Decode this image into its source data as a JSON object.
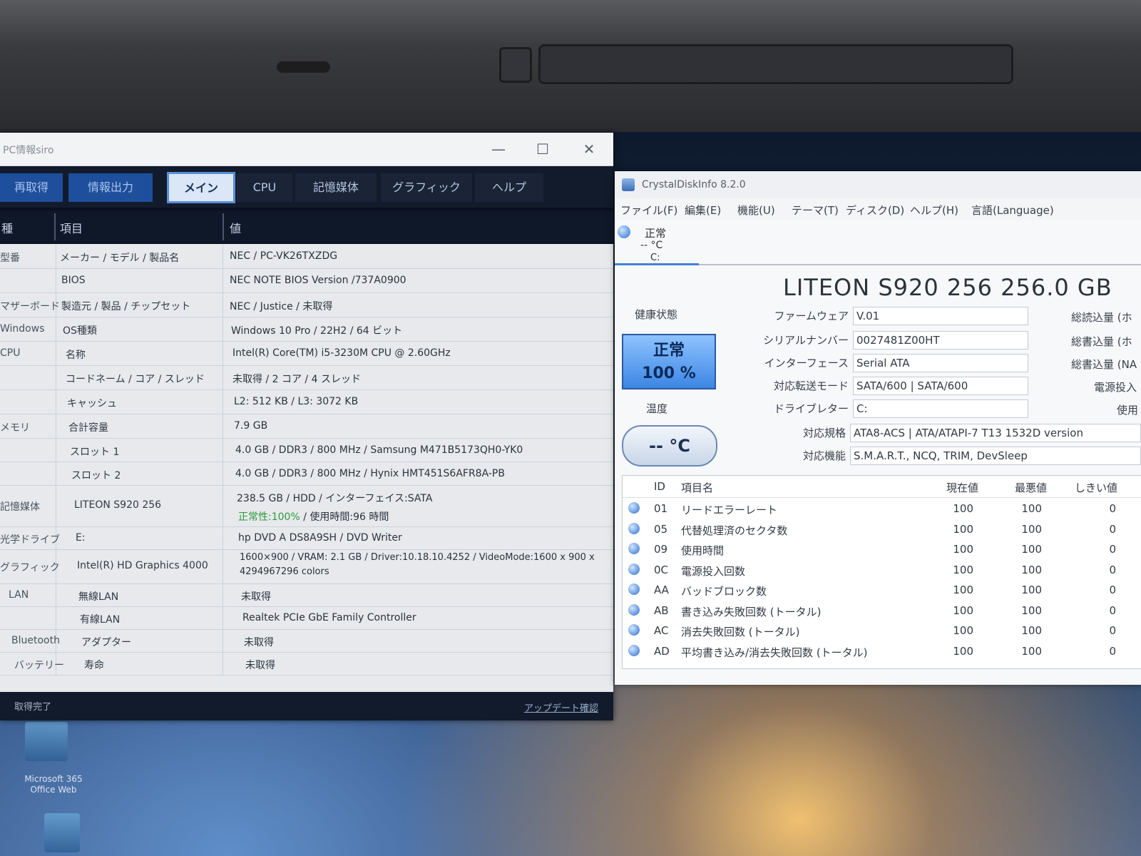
{
  "desktop": {
    "icon_label": "Microsoft 365 Office Web"
  },
  "pcinfo": {
    "title": "PC情報siro",
    "window_buttons": {
      "minimize": "—",
      "maximize": "☐",
      "close": "✕"
    },
    "toolbar": {
      "refresh": "再取得",
      "export": "情報出力",
      "tabs": [
        "メイン",
        "CPU",
        "記憶媒体",
        "グラフィック",
        "ヘルプ"
      ]
    },
    "columns": {
      "category": "種",
      "item": "項目",
      "value": "値"
    },
    "rows": [
      {
        "category": "型番",
        "item": "メーカー / モデル / 製品名",
        "value": "NEC / PC-VK26TXZDG"
      },
      {
        "category": "",
        "item": "BIOS",
        "value": "NEC NOTE BIOS Version /737A0900"
      },
      {
        "category": "マザーボード",
        "item": "製造元 / 製品 / チップセット",
        "value": "NEC / Justice / 未取得"
      },
      {
        "category": "Windows",
        "item": "OS種類",
        "value": "Windows 10 Pro / 22H2 / 64 ビット"
      },
      {
        "category": "CPU",
        "item": "名称",
        "value": "Intel(R) Core(TM) i5-3230M CPU @ 2.60GHz"
      },
      {
        "category": "",
        "item": "コードネーム / コア / スレッド",
        "value": "未取得 / 2 コア / 4 スレッド"
      },
      {
        "category": "",
        "item": "キャッシュ",
        "value": "L2: 512 KB / L3: 3072 KB"
      },
      {
        "category": "メモリ",
        "item": "合計容量",
        "value": "7.9 GB"
      },
      {
        "category": "",
        "item": "スロット 1",
        "value": "4.0 GB / DDR3 / 800 MHz / Samsung M471B5173QH0-YK0"
      },
      {
        "category": "",
        "item": "スロット 2",
        "value": "4.0 GB / DDR3 / 800 MHz / Hynix HMT451S6AFR8A-PB"
      },
      {
        "category": "記憶媒体",
        "item": "LITEON S920 256",
        "value": "238.5 GB / HDD / インターフェイス:SATA",
        "value_health": "正常性:100%",
        "value_hours": " / 使用時間:96 時間"
      },
      {
        "category": "光学ドライブ",
        "item": "E:",
        "value": "hp DVD A DS8A9SH / DVD Writer"
      },
      {
        "category": "グラフィック",
        "item": "Intel(R) HD Graphics 4000",
        "value": "1600×900 / VRAM: 2.1 GB / Driver:10.18.10.4252 / VideoMode:1600 x 900 x",
        "value2": "4294967296 colors"
      },
      {
        "category": "LAN",
        "item": "無線LAN",
        "value": "未取得"
      },
      {
        "category": "",
        "item": "有線LAN",
        "value": "Realtek PCIe GbE Family Controller"
      },
      {
        "category": "Bluetooth",
        "item": "アダプター",
        "value": "未取得"
      },
      {
        "category": "バッテリー",
        "item": "寿命",
        "value": "未取得"
      }
    ],
    "status": {
      "left": "取得完了",
      "update_link": "アップデート確認"
    }
  },
  "cdi": {
    "title": "CrystalDiskInfo 8.2.0",
    "menu": [
      "ファイル(F)",
      "編集(E)",
      "機能(U)",
      "テーマ(T)",
      "ディスク(D)",
      "ヘルプ(H)",
      "言語(Language)"
    ],
    "drive_tab": {
      "status": "正常",
      "temp": "-- °C",
      "letter": "C:"
    },
    "model": "LITEON S920 256 256.0 GB",
    "health_label": "健康状態",
    "health_status": "正常",
    "health_percent": "100 %",
    "temp_label": "温度",
    "temp_value": "-- °C",
    "fields": [
      {
        "label": "ファームウェア",
        "value": "V.01"
      },
      {
        "label": "シリアルナンバー",
        "value": "0027481Z00HT"
      },
      {
        "label": "インターフェース",
        "value": "Serial ATA"
      },
      {
        "label": "対応転送モード",
        "value": "SATA/600 | SATA/600"
      },
      {
        "label": "ドライブレター",
        "value": "C:"
      },
      {
        "label": "対応規格",
        "value": "ATA8-ACS | ATA/ATAPI-7 T13 1532D version"
      },
      {
        "label": "対応機能",
        "value": "S.M.A.R.T., NCQ, TRIM, DevSleep"
      }
    ],
    "right_labels": [
      "総読込量 (ホ",
      "総書込量 (ホ",
      "総書込量 (NA",
      "電源投入",
      "使用"
    ],
    "smart_columns": {
      "id": "ID",
      "name": "項目名",
      "current": "現在値",
      "worst": "最悪値",
      "threshold": "しきい値"
    },
    "smart_rows": [
      {
        "id": "01",
        "name": "リードエラーレート",
        "current": "100",
        "worst": "100",
        "threshold": "0"
      },
      {
        "id": "05",
        "name": "代替処理済のセクタ数",
        "current": "100",
        "worst": "100",
        "threshold": "0"
      },
      {
        "id": "09",
        "name": "使用時間",
        "current": "100",
        "worst": "100",
        "threshold": "0"
      },
      {
        "id": "0C",
        "name": "電源投入回数",
        "current": "100",
        "worst": "100",
        "threshold": "0"
      },
      {
        "id": "AA",
        "name": "バッドブロック数",
        "current": "100",
        "worst": "100",
        "threshold": "0"
      },
      {
        "id": "AB",
        "name": "書き込み失敗回数 (トータル)",
        "current": "100",
        "worst": "100",
        "threshold": "0"
      },
      {
        "id": "AC",
        "name": "消去失敗回数 (トータル)",
        "current": "100",
        "worst": "100",
        "threshold": "0"
      },
      {
        "id": "AD",
        "name": "平均書き込み/消去失敗回数 (トータル)",
        "current": "100",
        "worst": "100",
        "threshold": "0"
      }
    ]
  }
}
